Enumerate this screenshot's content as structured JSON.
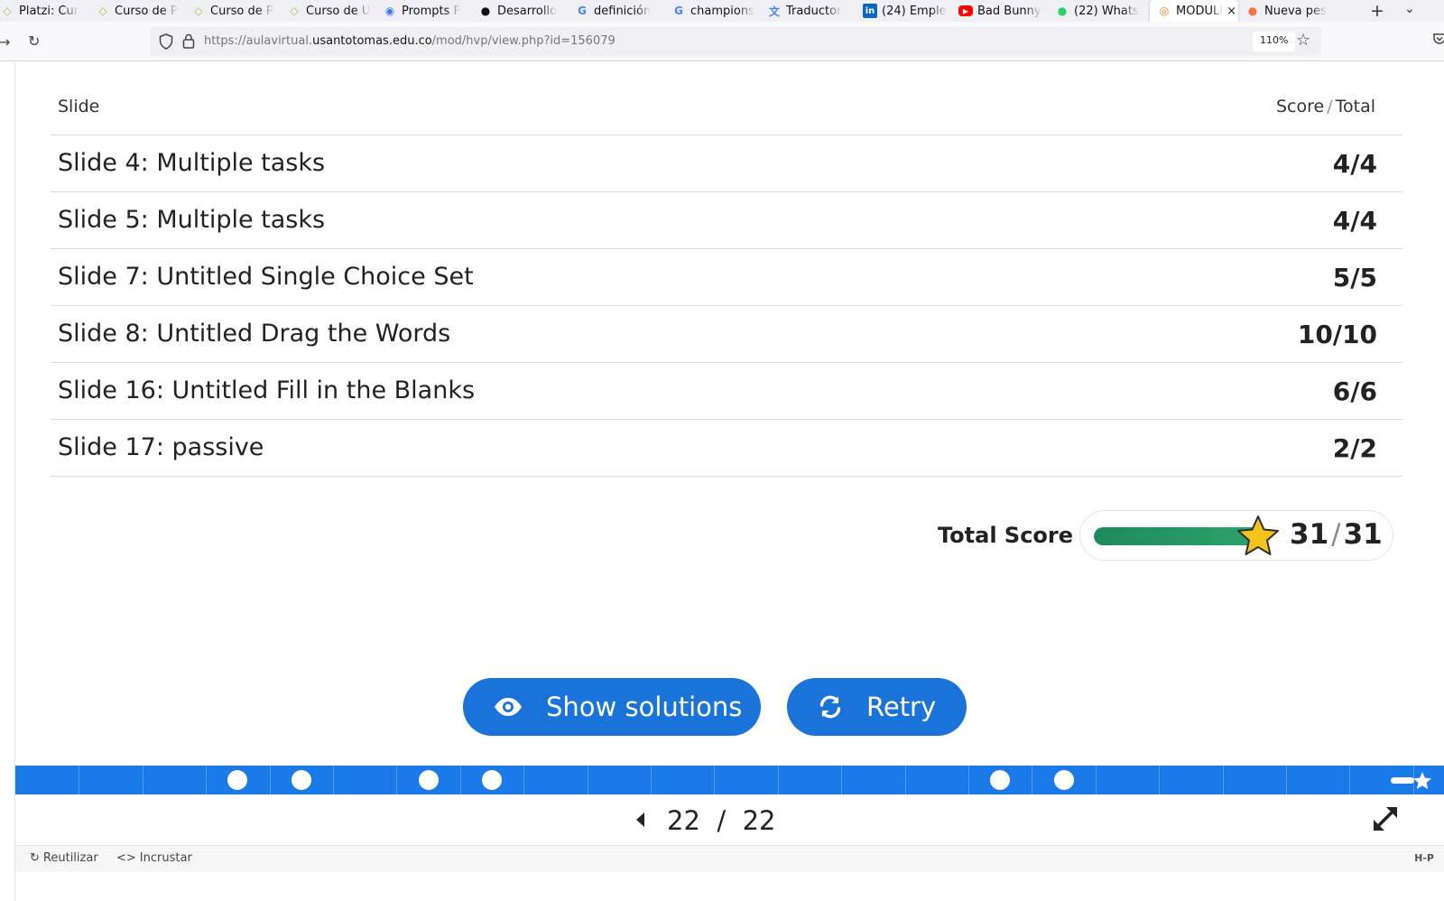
{
  "browser": {
    "tabs": [
      {
        "title": "Platzi: Cur",
        "icon": "platzi-icon",
        "color": "#98ca3f"
      },
      {
        "title": "Curso de P",
        "icon": "platzi-icon",
        "color": "#98ca3f"
      },
      {
        "title": "Curso de P",
        "icon": "platzi-icon",
        "color": "#98ca3f"
      },
      {
        "title": "Curso de U",
        "icon": "platzi-icon",
        "color": "#98ca3f"
      },
      {
        "title": "Prompts P",
        "icon": "prompts-icon",
        "color": "#3b7bf0"
      },
      {
        "title": "Desarrollo",
        "icon": "openai-icon",
        "color": "#111111"
      },
      {
        "title": "definición",
        "icon": "google-icon",
        "color": "#4285f4"
      },
      {
        "title": "champions",
        "icon": "google-icon",
        "color": "#4285f4"
      },
      {
        "title": "Traductor",
        "icon": "translate-icon",
        "color": "#4285f4"
      },
      {
        "title": "(24) Emple",
        "icon": "linkedin-icon",
        "color": "#0a66c2"
      },
      {
        "title": "Bad Bunny",
        "icon": "youtube-icon",
        "color": "#ff0000"
      },
      {
        "title": "(22) Whats",
        "icon": "whatsapp-icon",
        "color": "#25d366"
      },
      {
        "title": "MODULI",
        "icon": "moodle-icon",
        "color": "#f98012",
        "active": true
      },
      {
        "title": "Nueva pes",
        "icon": "firefox-icon",
        "color": "#ff7139"
      }
    ],
    "url_prefix": "https://aulavirtual.",
    "url_host": "usantotomas.edu.co",
    "url_path": "/mod/hvp/view.php?id=156079",
    "zoom": "110%"
  },
  "summary": {
    "header_slide": "Slide",
    "header_score": "Score",
    "header_sep": "/",
    "header_total": "Total",
    "rows": [
      {
        "title": "Slide 4: Multiple tasks",
        "score": "4/4"
      },
      {
        "title": "Slide 5: Multiple tasks",
        "score": "4/4"
      },
      {
        "title": "Slide 7: Untitled Single Choice Set",
        "score": "5/5"
      },
      {
        "title": "Slide 8: Untitled Drag the Words",
        "score": "10/10"
      },
      {
        "title": "Slide 16: Untitled Fill in the Blanks",
        "score": "6/6"
      },
      {
        "title": "Slide 17: passive",
        "score": "2/2"
      }
    ]
  },
  "total": {
    "label": "Total Score",
    "score": "31",
    "sep": "/",
    "max": "31",
    "progress_fraction": 1.0
  },
  "buttons": {
    "show_solutions": "Show solutions",
    "retry": "Retry"
  },
  "progress": {
    "segments": 22,
    "answered_slides": [
      4,
      5,
      7,
      8,
      16,
      17
    ],
    "color": "#1a7be8"
  },
  "pager": {
    "current": "22",
    "sep": "/",
    "total": "22"
  },
  "footer": {
    "reuse": "Reutilizar",
    "embed": "Incrustar",
    "logo": "H-P"
  },
  "colors": {
    "primary": "#1a73d9",
    "success": "#2ea36c",
    "star": "#f6c21c"
  }
}
